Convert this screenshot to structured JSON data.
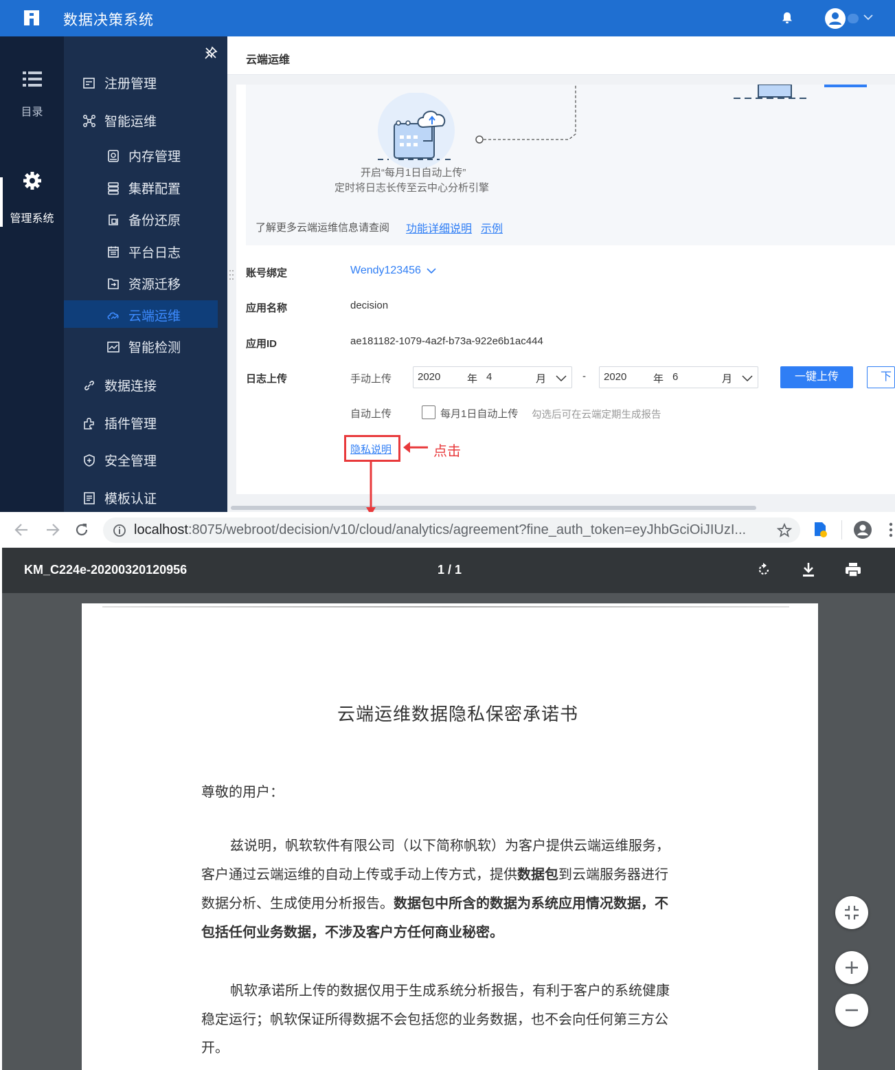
{
  "app": {
    "title": "数据决策系统"
  },
  "rail": {
    "items": [
      {
        "label": "目录",
        "icon": "list-icon"
      },
      {
        "label": "管理系统",
        "icon": "gear-icon"
      }
    ]
  },
  "nav": {
    "items": [
      {
        "label": "注册管理",
        "icon": "register-icon"
      },
      {
        "label": "智能运维",
        "icon": "ops-icon"
      },
      {
        "label": "内存管理",
        "icon": "memory-icon"
      },
      {
        "label": "集群配置",
        "icon": "cluster-icon"
      },
      {
        "label": "备份还原",
        "icon": "backup-icon"
      },
      {
        "label": "平台日志",
        "icon": "log-icon"
      },
      {
        "label": "资源迁移",
        "icon": "migrate-icon"
      },
      {
        "label": "云端运维",
        "icon": "cloud-icon"
      },
      {
        "label": "智能检测",
        "icon": "detect-icon"
      },
      {
        "label": "数据连接",
        "icon": "link-icon"
      },
      {
        "label": "插件管理",
        "icon": "plugin-icon"
      },
      {
        "label": "安全管理",
        "icon": "shield-icon"
      },
      {
        "label": "模板认证",
        "icon": "template-icon"
      }
    ]
  },
  "content": {
    "title": "云端运维",
    "banner": {
      "caption_line1": "开启“每月1日自动上传”",
      "caption_line2": "定时将日志长传至云中心分析引擎",
      "more_text": "了解更多云端运维信息请查阅",
      "detail_link": "功能详细说明",
      "example_link": "示例"
    },
    "account": {
      "label": "账号绑定",
      "value": "Wendy123456"
    },
    "app_name": {
      "label": "应用名称",
      "value": "decision"
    },
    "app_id": {
      "label": "应用ID",
      "value": "ae181182-1079-4a2f-b73a-922e6b1ac444"
    },
    "log_upload": {
      "label": "日志上传",
      "manual_label": "手动上传",
      "start_year": "2020",
      "year_unit": "年",
      "start_month": "4",
      "month_unit": "月",
      "separator": "-",
      "end_year": "2020",
      "end_month": "6",
      "upload_button": "一键上传",
      "download_button": "下载",
      "auto_label": "自动上传",
      "auto_checkbox": "每月1日自动上传",
      "auto_hint": "勾选后可在云端定期生成报告",
      "privacy_link": "隐私说明"
    },
    "annotation": "点击"
  },
  "browser": {
    "url_host": "localhost",
    "url_rest": ":8075/webroot/decision/v10/cloud/analytics/agreement?fine_auth_token=eyJhbGciOiJIUzI..."
  },
  "pdf": {
    "file_name": "KM_C224e-20200320120956",
    "page_indicator": "1 / 1",
    "title": "云端运维数据隐私保密承诺书",
    "salutation": "尊敬的用户：",
    "para1": {
      "l1": "兹说明，帆软软件有限公司（以下简称帆软）为客户提供云端运维服务，",
      "l2a": "客户通过云端运维的自动上传或手动上传方式，提供",
      "l2b": "数据包",
      "l2c": "到云端服务器进行",
      "l3a": "数据分析、生成使用分析报告。",
      "l3b": "数据包中所含的数据为系统应用情况数据，不",
      "l4": "包括任何业务数据，不涉及客户方任何商业秘密。"
    },
    "para2": {
      "l1": "帆软承诺所上传的数据仅用于生成系统分析报告，有利于客户的系统健康",
      "l2": "稳定运行；帆软保证所得数据不会包括您的业务数据，也不会向任何第三方公",
      "l3": "开。"
    }
  },
  "colors": {
    "brand": "#1f6fd1",
    "sidebar": "#1b2f4e",
    "link": "#2f7ef5",
    "annotation": "#e8393b"
  }
}
